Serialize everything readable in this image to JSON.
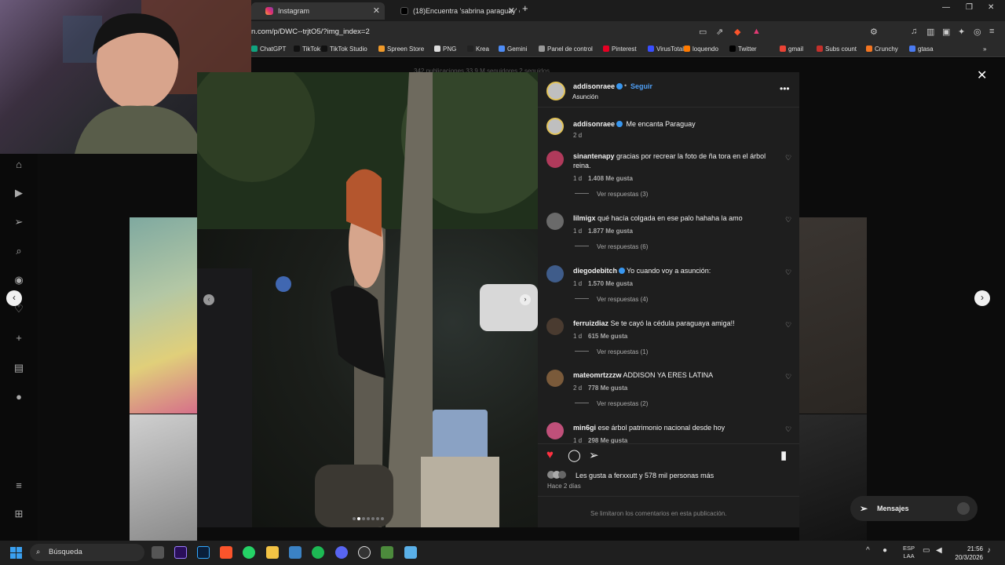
{
  "browser": {
    "tabs": [
      {
        "title": "Instagram"
      },
      {
        "title": "(18)Encuentra 'sabrina paraguay' en T"
      }
    ],
    "url": "n.com/p/DWC--trjtO5/?img_index=2",
    "bookmarks": [
      "ChatGPT",
      "TikTok",
      "TikTok Studio",
      "Spreen Store",
      "PNG",
      "Krea",
      "Gemini",
      "Panel de control",
      "Pinterest",
      "VirusTotal",
      "loquendo",
      "Twitter",
      "gmail",
      "Subs count",
      "Crunchy",
      "gtasa"
    ]
  },
  "profile_peek": {
    "text": "342 publicaciones   33,9 M seguidores   2 seguidos"
  },
  "post": {
    "author": "addisonraee",
    "follow_label": "Seguir",
    "location": "Asunción",
    "caption": "Me encanta Paraguay",
    "caption_age": "2 d",
    "comments": [
      {
        "user": "sinantenapy",
        "text": "gracias por recrear la foto de ña tora en el árbol reina.",
        "age": "1 d",
        "likes": "1.408 Me gusta",
        "replies": "Ver respuestas (3)",
        "avatar_color": "#b03a5b"
      },
      {
        "user": "lilmigx",
        "text": "qué hacía colgada en ese palo hahaha la amo",
        "age": "1 d",
        "likes": "1.877 Me gusta",
        "replies": "Ver respuestas (6)",
        "avatar_color": "#6a6a6a"
      },
      {
        "user": "diegodebitch",
        "text": "Yo cuando voy a asunción:",
        "age": "1 d",
        "likes": "1.570 Me gusta",
        "replies": "Ver respuestas (4)",
        "avatar_color": "#3f5c8a"
      },
      {
        "user": "ferruizdiaz",
        "text": "Se te cayó la cédula paraguaya amiga!!",
        "age": "1 d",
        "likes": "615 Me gusta",
        "replies": "Ver respuestas (1)",
        "avatar_color": "#4a3b30"
      },
      {
        "user": "mateomrtzzzw",
        "text": "ADDISON YA ERES LATINA",
        "age": "2 d",
        "likes": "778 Me gusta",
        "replies": "Ver respuestas (2)",
        "avatar_color": "#7a5a3a"
      },
      {
        "user": "min6gi",
        "text": "ese árbol patrimonio nacional desde hoy",
        "age": "1 d",
        "likes": "298 Me gusta",
        "replies": "",
        "avatar_color": "#c0507a"
      }
    ],
    "likes_text": "Les gusta a ferxxutt y 578 mil personas más",
    "posted_ago": "Hace 2 días",
    "comments_limited": "Se limitaron los comentarios en esta publicación."
  },
  "messages_label": "Mensajes",
  "taskbar": {
    "search_placeholder": "Búsqueda",
    "lang": "ESP",
    "lang2": "LAA",
    "time": "21:56",
    "date": "20/3/2026"
  },
  "colors": {
    "accent": "#0095f6",
    "heart": "#ff3040",
    "verified": "#3897f0"
  }
}
